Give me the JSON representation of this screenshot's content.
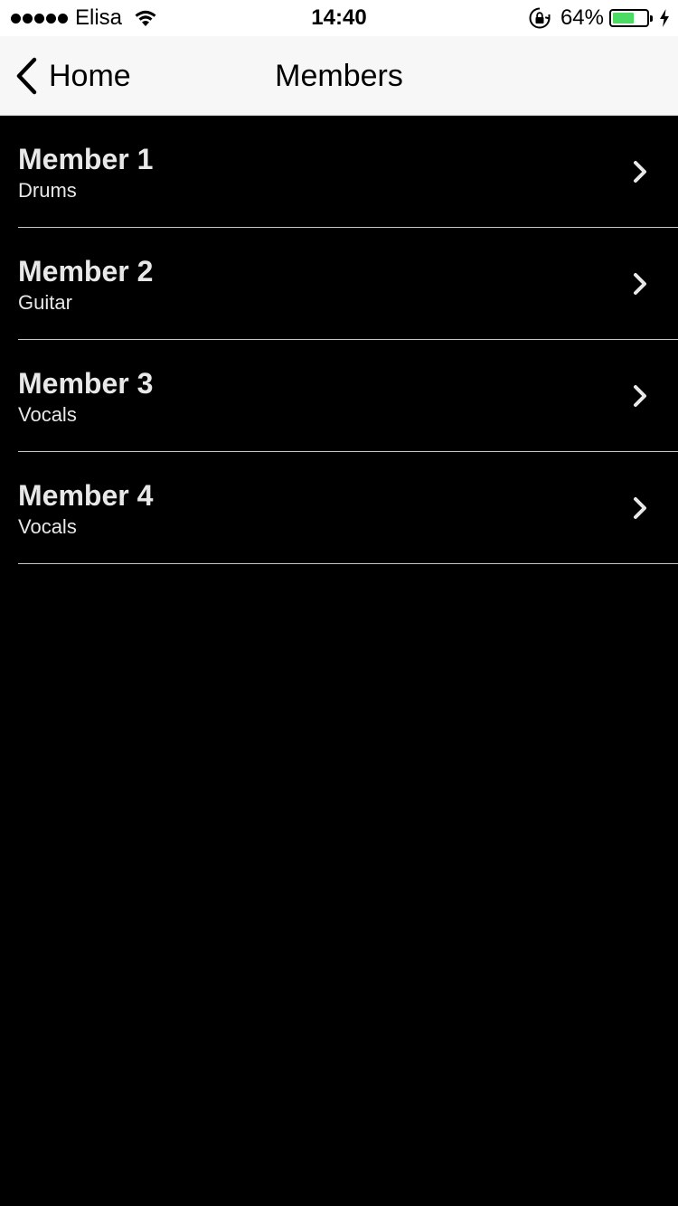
{
  "status_bar": {
    "carrier": "Elisa",
    "time": "14:40",
    "battery_percent": "64%",
    "battery_level": 0.64,
    "battery_color": "#4cd964",
    "icons": [
      "signal-dots-icon",
      "wifi-icon",
      "lock-rotation-icon",
      "battery-icon",
      "charging-icon"
    ]
  },
  "nav": {
    "back_label": "Home",
    "title": "Members",
    "back_icon": "chevron-left-icon"
  },
  "members": [
    {
      "name": "Member 1",
      "role": "Drums"
    },
    {
      "name": "Member 2",
      "role": "Guitar"
    },
    {
      "name": "Member 3",
      "role": "Vocals"
    },
    {
      "name": "Member 4",
      "role": "Vocals"
    }
  ],
  "colors": {
    "background": "#000000",
    "nav_background": "#f7f7f7",
    "list_text": "#e8e8e8",
    "separator": "#c8c7cc"
  }
}
